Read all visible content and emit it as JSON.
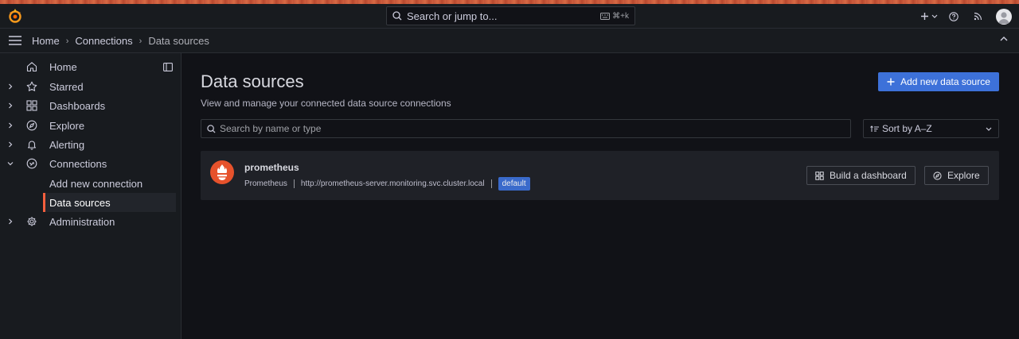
{
  "topbar": {
    "search_placeholder": "Search or jump to...",
    "search_shortcut": "⌘+k"
  },
  "breadcrumb": [
    "Home",
    "Connections",
    "Data sources"
  ],
  "sidebar": {
    "items": [
      {
        "label": "Home",
        "icon": "home-icon"
      },
      {
        "label": "Starred",
        "icon": "star-icon"
      },
      {
        "label": "Dashboards",
        "icon": "apps-icon"
      },
      {
        "label": "Explore",
        "icon": "compass-icon"
      },
      {
        "label": "Alerting",
        "icon": "bell-icon"
      },
      {
        "label": "Connections",
        "icon": "connections-icon"
      },
      {
        "label": "Add new connection"
      },
      {
        "label": "Data sources"
      },
      {
        "label": "Administration",
        "icon": "cog-icon"
      }
    ]
  },
  "main": {
    "title": "Data sources",
    "subtitle": "View and manage your connected data source connections",
    "add_button": "Add new data source",
    "filter_placeholder": "Search by name or type",
    "sort_label": "Sort by A–Z"
  },
  "datasources": [
    {
      "name": "prometheus",
      "type": "Prometheus",
      "url": "http://prometheus-server.monitoring.svc.cluster.local",
      "badge": "default",
      "build_button": "Build a dashboard",
      "explore_button": "Explore"
    }
  ],
  "colors": {
    "accent": "#3d71d9",
    "active_indicator": "#f55f3e",
    "prometheus": "#e6522c"
  }
}
